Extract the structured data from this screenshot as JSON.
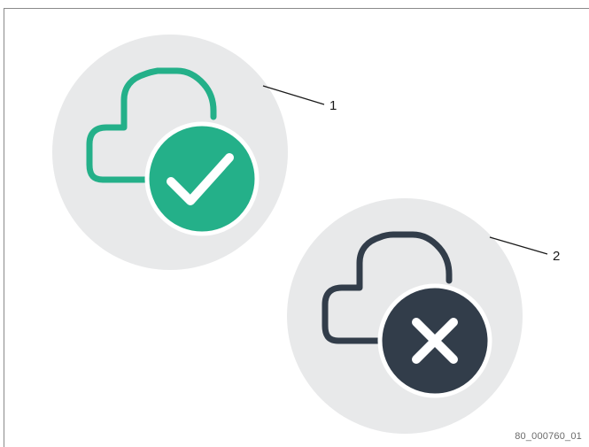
{
  "callouts": {
    "connected": {
      "number": "1"
    },
    "disconnected": {
      "number": "2"
    }
  },
  "figure_id": "80_000760_01",
  "icons": {
    "connected": "cloud-connected-icon",
    "disconnected": "cloud-disconnected-icon"
  },
  "colors": {
    "badge_background": "#e8e9ea",
    "connected_accent": "#24b089",
    "disconnected_accent": "#323d4a",
    "callout_line": "#1a1a1a"
  }
}
